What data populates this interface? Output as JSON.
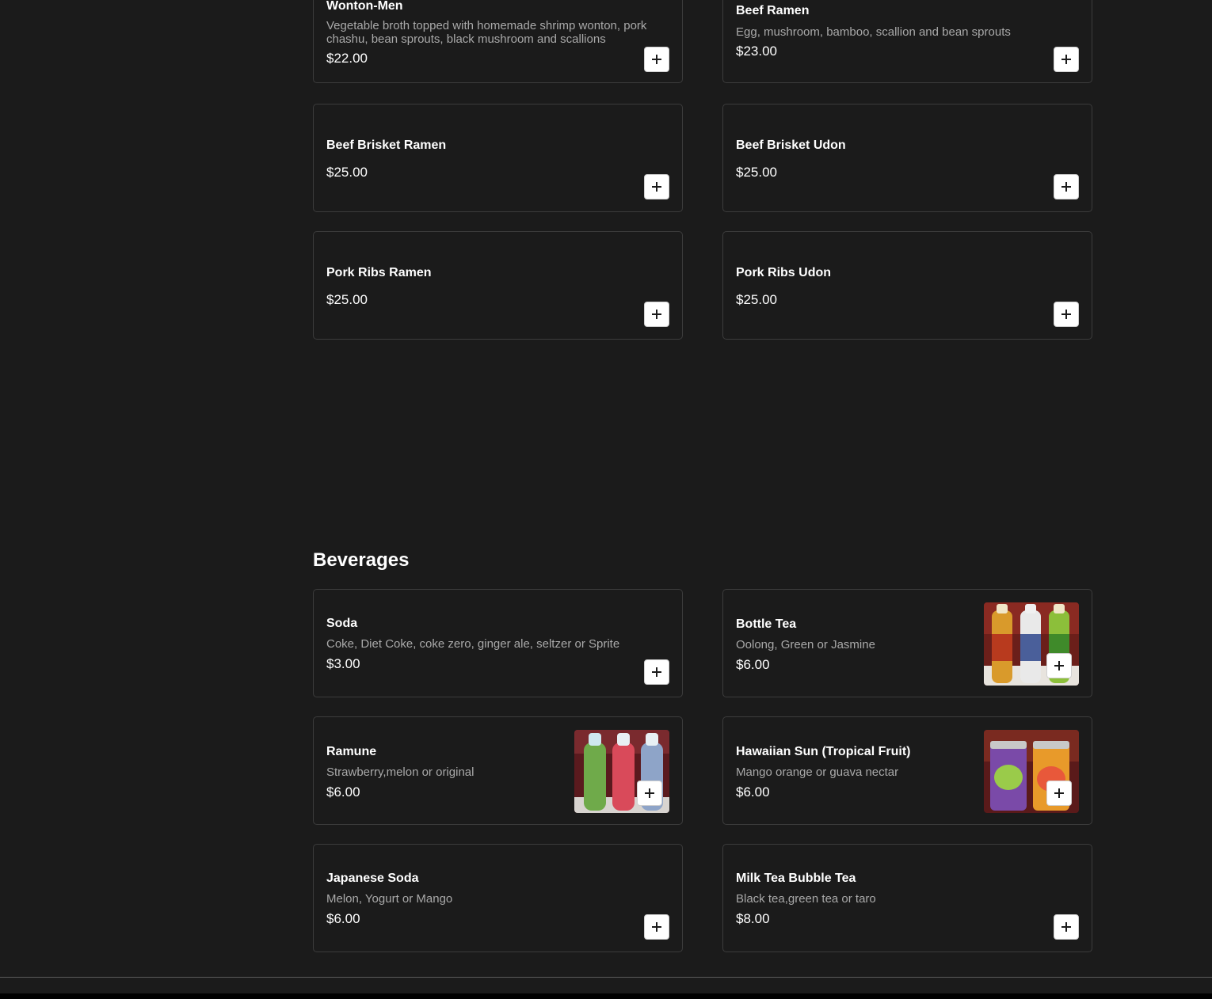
{
  "ramen_items": [
    {
      "name": "Wonton-Men",
      "description": "Vegetable broth topped with homemade shrimp wonton, pork chashu, bean sprouts, black mushroom and scallions",
      "price": "$22.00"
    },
    {
      "name": "Beef Ramen",
      "description": "Egg, mushroom, bamboo, scallion and bean sprouts",
      "price": "$23.00"
    },
    {
      "name": "Beef Brisket Ramen",
      "price": "$25.00"
    },
    {
      "name": "Beef Brisket Udon",
      "price": "$25.00"
    },
    {
      "name": "Pork Ribs Ramen",
      "price": "$25.00"
    },
    {
      "name": "Pork Ribs Udon",
      "price": "$25.00"
    }
  ],
  "beverages": {
    "title": "Beverages",
    "items": [
      {
        "name": "Soda",
        "description": "Coke, Diet Coke, coke zero, ginger ale, seltzer or Sprite",
        "price": "$3.00"
      },
      {
        "name": "Bottle Tea",
        "description": "Oolong, Green or Jasmine",
        "price": "$6.00",
        "image": "tea-bottles-photo"
      },
      {
        "name": "Ramune",
        "description": "Strawberry,melon or original",
        "price": "$6.00",
        "image": "ramune-bottles-photo"
      },
      {
        "name": "Hawaiian Sun (Tropical Fruit)",
        "description": "Mango orange or guava nectar",
        "price": "$6.00",
        "image": "juice-cans-photo"
      },
      {
        "name": "Japanese Soda",
        "description": "Melon, Yogurt or Mango",
        "price": "$6.00"
      },
      {
        "name": "Milk Tea Bubble Tea",
        "description": "Black tea,green tea or taro",
        "price": "$8.00"
      }
    ]
  },
  "icons": {
    "add": "plus-icon"
  },
  "colors": {
    "background": "#1b1b1b",
    "card_border": "#3c3c3c",
    "description_text": "#a9a9a9",
    "button_background": "#ffffff"
  }
}
